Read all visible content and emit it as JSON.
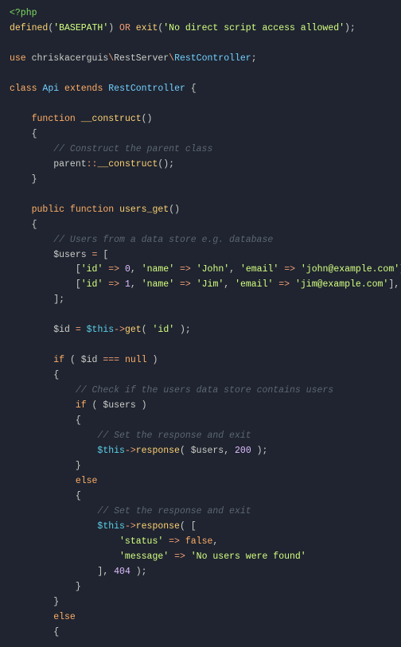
{
  "l1_open": "<?php",
  "l2_def": "defined",
  "l2_str": "'BASEPATH'",
  "l2_or": "OR",
  "l2_exit": "exit",
  "l2_str2": "'No direct script access allowed'",
  "l3_use": "use",
  "l3_ns1": "chriskacerguis",
  "l3_ns2": "RestServer",
  "l3_ns3": "RestController",
  "l4_class": "class",
  "l4_name": "Api",
  "l4_ext": "extends",
  "l4_parent": "RestController",
  "l5_fn": "function",
  "l5_name": "__construct",
  "l6_c": "// Construct the parent class",
  "l7_parent": "parent",
  "l7_con": "__construct",
  "l8_vis": "public",
  "l8_fn": "function",
  "l8_name": "users_get",
  "l9_c": "// Users from a data store e.g. database",
  "l10_var": "$users",
  "l11_id": "'id'",
  "l11_n0": "0",
  "l11_name": "'name'",
  "l11_john": "'John'",
  "l11_email": "'email'",
  "l11_je": "'john@example.com'",
  "l12_n1": "1",
  "l12_jim": "'Jim'",
  "l12_je": "'jim@example.com'",
  "l13_idv": "$id",
  "l13_this": "$this",
  "l13_get": "get",
  "l13_idk": "'id'",
  "l14_if": "if",
  "l14_null": "null",
  "l15_c": "// Check if the users data store contains users",
  "l16_c": "// Set the response and exit",
  "l17_resp": "response",
  "l17_200": "200",
  "l18_else": "else",
  "l19_c": "// Set the response and exit",
  "l20_status": "'status'",
  "l20_false": "false",
  "l21_msg": "'message'",
  "l21_txt": "'No users were found'",
  "l22_404": "404"
}
